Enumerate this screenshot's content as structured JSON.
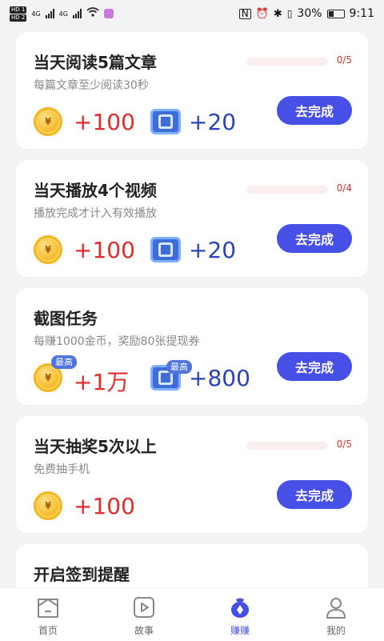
{
  "status_bar": {
    "time": "9:11",
    "battery": "30%",
    "hd1": "HD 1",
    "hd2": "HD 2",
    "net1": "4G",
    "net2": "4G"
  },
  "tasks": [
    {
      "title": "当天阅读5篇文章",
      "subtitle": "每篇文章至少阅读30秒",
      "progress_text": "0/5",
      "progress": 0,
      "coin_reward": "+100",
      "ticket_reward": "+20",
      "button": "去完成"
    },
    {
      "title": "当天播放4个视频",
      "subtitle": "播放完成才计入有效播放",
      "progress_text": "0/4",
      "progress": 0,
      "coin_reward": "+100",
      "ticket_reward": "+20",
      "button": "去完成"
    },
    {
      "title": "截图任务",
      "subtitle": "每赚1000金币，奖励80张提现券",
      "coin_reward": "+1万",
      "ticket_reward": "+800",
      "coin_badge": "最高",
      "ticket_badge": "最高",
      "button": "去完成"
    },
    {
      "title": "当天抽奖5次以上",
      "subtitle": "免费抽手机",
      "progress_text": "0/5",
      "progress": 0,
      "coin_reward": "+100",
      "button": "去完成"
    },
    {
      "title": "开启签到提醒"
    }
  ],
  "coin_symbol": "¥",
  "bottom_nav": [
    {
      "label": "首页",
      "icon": "home-icon"
    },
    {
      "label": "故事",
      "icon": "play-icon"
    },
    {
      "label": "赚赚",
      "icon": "money-bag-icon",
      "active": true
    },
    {
      "label": "我的",
      "icon": "profile-icon"
    }
  ],
  "colors": {
    "accent": "#4750e6",
    "reward_red": "#e22c2c",
    "ticket_blue": "#2a43b8",
    "background": "#f3f3f5"
  }
}
